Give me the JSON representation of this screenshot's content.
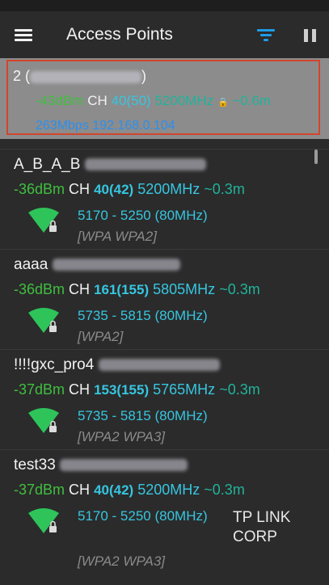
{
  "header": {
    "title": "Access Points"
  },
  "connected": {
    "ssid": "2 (",
    "ssid_close": ")",
    "signal": "-43dBm",
    "ch_label": "CH",
    "channel": "40(50)",
    "freq": "5200MHz",
    "lock_icon": "🔒",
    "distance": "~0.6m",
    "speed": "263Mbps",
    "ip": "192.168.0.104"
  },
  "access_points": [
    {
      "ssid": "A_B_A_B",
      "signal": "-36dBm",
      "ch_label": "CH",
      "channel": "40(42)",
      "freq": "5200MHz",
      "distance": "~0.3m",
      "range": "5170  -  5250 (80MHz)",
      "security": "[WPA  WPA2]",
      "vendor": ""
    },
    {
      "ssid": "aaaa",
      "signal": "-36dBm",
      "ch_label": "CH",
      "channel": "161(155)",
      "freq": "5805MHz",
      "distance": "~0.3m",
      "range": "5735  -  5815 (80MHz)",
      "security": "[WPA2]",
      "vendor": ""
    },
    {
      "ssid": "!!!!gxc_pro4",
      "signal": "-37dBm",
      "ch_label": "CH",
      "channel": "153(155)",
      "freq": "5765MHz",
      "distance": "~0.3m",
      "range": "5735  -  5815 (80MHz)",
      "security": "[WPA2  WPA3]",
      "vendor": ""
    },
    {
      "ssid": "test33",
      "signal": "-37dBm",
      "ch_label": "CH",
      "channel": "40(42)",
      "freq": "5200MHz",
      "distance": "~0.3m",
      "range": "5170  -  5250 (80MHz)",
      "security": "[WPA2  WPA3]",
      "vendor": "TP  LINK CORP"
    }
  ],
  "colors": {
    "signal": "#3fbf3f",
    "channel": "#36c6e0",
    "freq": "#21b39a",
    "highlight_border": "#d2452c",
    "accent": "#1e9be6"
  },
  "icons": {
    "menu": "menu-icon",
    "filter": "filter-icon",
    "pause": "pause-icon",
    "wifi": "wifi-lock-icon"
  }
}
